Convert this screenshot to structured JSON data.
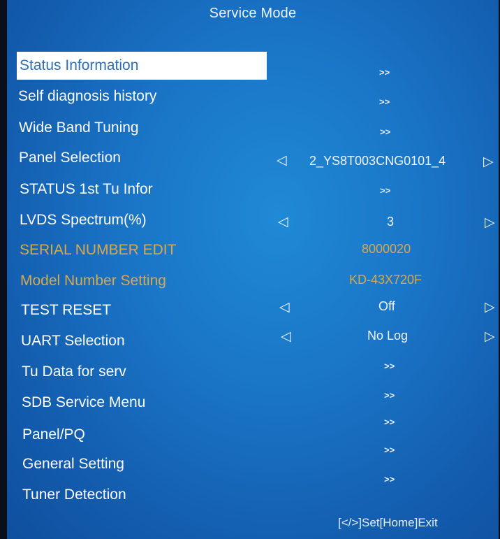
{
  "title": "Service Mode",
  "menu": [
    {
      "label": "Status Information",
      "action": ">>",
      "selected": true
    },
    {
      "label": "Self diagnosis history",
      "action": ">>"
    },
    {
      "label": "Wide Band Tuning",
      "action": ">>"
    },
    {
      "label": "Panel Selection",
      "left": "◁",
      "value": "2_YS8T003CNG0101_4",
      "right": "▷"
    },
    {
      "label": "STATUS 1st Tu Infor",
      "action": ">>"
    },
    {
      "label": "LVDS Spectrum(%)",
      "left": "◁",
      "value": "3",
      "right": "▷"
    },
    {
      "label": "SERIAL NUMBER EDIT",
      "value": "8000020",
      "gold": true
    },
    {
      "label": "Model Number Setting",
      "value": "KD-43X720F",
      "gold": true
    },
    {
      "label": "TEST RESET",
      "left": "◁",
      "value": "Off",
      "right": "▷"
    },
    {
      "label": "UART Selection",
      "left": "◁",
      "value": "No Log",
      "right": "▷"
    },
    {
      "label": "Tu Data for serv",
      "action": ">>"
    },
    {
      "label": "SDB Service Menu",
      "action": ">>"
    },
    {
      "label": "Panel/PQ",
      "action": ">>"
    },
    {
      "label": "General Setting",
      "action": ">>"
    },
    {
      "label": "Tuner Detection",
      "action": ">>"
    }
  ],
  "footer": "[</>]Set[Home]Exit",
  "colors": {
    "background": "#1a74c6",
    "highlight_bg": "#ffffff",
    "highlight_text": "#2d6fb5",
    "gold": "#d9a84a"
  }
}
